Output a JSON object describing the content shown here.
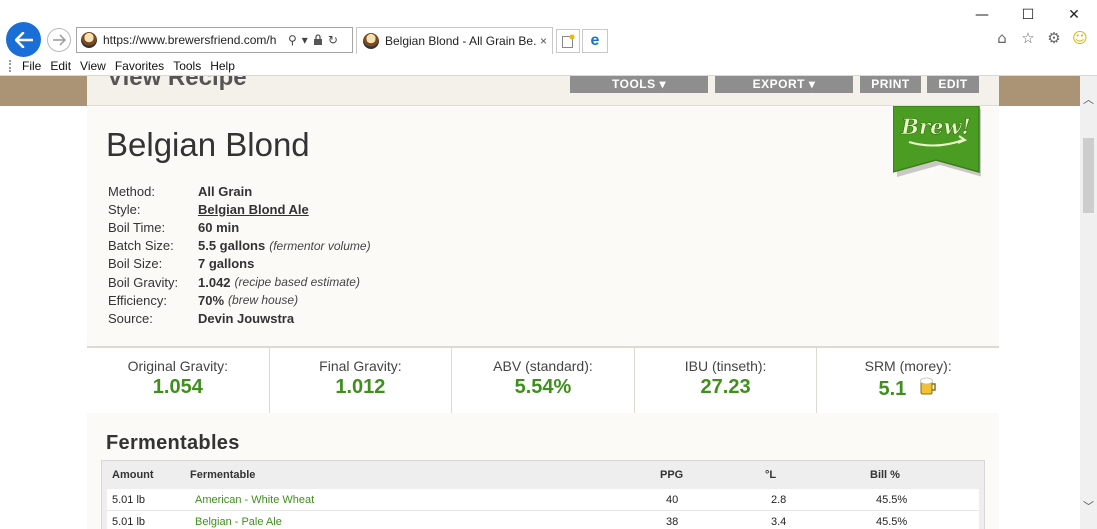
{
  "browser": {
    "url": "https://www.brewersfriend.com/h",
    "tab_title": "Belgian Blond - All Grain Be...",
    "tab_close": "×",
    "window_controls": {
      "minimize": "—",
      "maximize": "☐",
      "close": "✕"
    },
    "menu": [
      "File",
      "Edit",
      "View",
      "Favorites",
      "Tools",
      "Help"
    ],
    "icons": [
      "back-arrow-icon",
      "forward-arrow-icon",
      "search-icon",
      "dropdown-icon",
      "lock-icon",
      "refresh-icon",
      "home-icon",
      "favorites-star-icon",
      "settings-gear-icon",
      "smiley-feedback-icon"
    ]
  },
  "page": {
    "header_title": "View Recipe",
    "header_buttons": [
      "TOOLS ▾",
      "EXPORT ▾",
      "PRINT",
      "EDIT"
    ],
    "badge_text": "Brew!",
    "recipe_title": "Belgian Blond",
    "details": [
      {
        "label": "Method:",
        "value": "All Grain",
        "note": ""
      },
      {
        "label": "Style:",
        "value": "Belgian Blond Ale",
        "note": ""
      },
      {
        "label": "Boil Time:",
        "value": "60 min",
        "note": ""
      },
      {
        "label": "Batch Size:",
        "value": "5.5 gallons",
        "note": "(fermentor volume)"
      },
      {
        "label": "Boil Size:",
        "value": "7 gallons",
        "note": ""
      },
      {
        "label": "Boil Gravity:",
        "value": "1.042",
        "note": "(recipe based estimate)"
      },
      {
        "label": "Efficiency:",
        "value": "70%",
        "note": "(brew house)"
      },
      {
        "label": "Source:",
        "value": "Devin Jouwstra",
        "note": ""
      }
    ],
    "stats": [
      {
        "label": "Original Gravity:",
        "value": "1.054"
      },
      {
        "label": "Final Gravity:",
        "value": "1.012"
      },
      {
        "label": "ABV (standard):",
        "value": "5.54%"
      },
      {
        "label": "IBU (tinseth):",
        "value": "27.23"
      },
      {
        "label": "SRM (morey):",
        "value": "5.1"
      }
    ],
    "fermentables": {
      "heading": "Fermentables",
      "columns": [
        "Amount",
        "Fermentable",
        "PPG",
        "°L",
        "Bill %"
      ],
      "rows": [
        [
          "5.01 lb",
          "American - White Wheat",
          "40",
          "2.8",
          "45.5%"
        ],
        [
          "5.01 lb",
          "Belgian - Pale Ale",
          "38",
          "3.4",
          "45.5%"
        ]
      ]
    }
  },
  "colors": {
    "accent_green": "#3f8f1d",
    "header_band": "#ab9475",
    "back_button": "#1a6fd6"
  }
}
